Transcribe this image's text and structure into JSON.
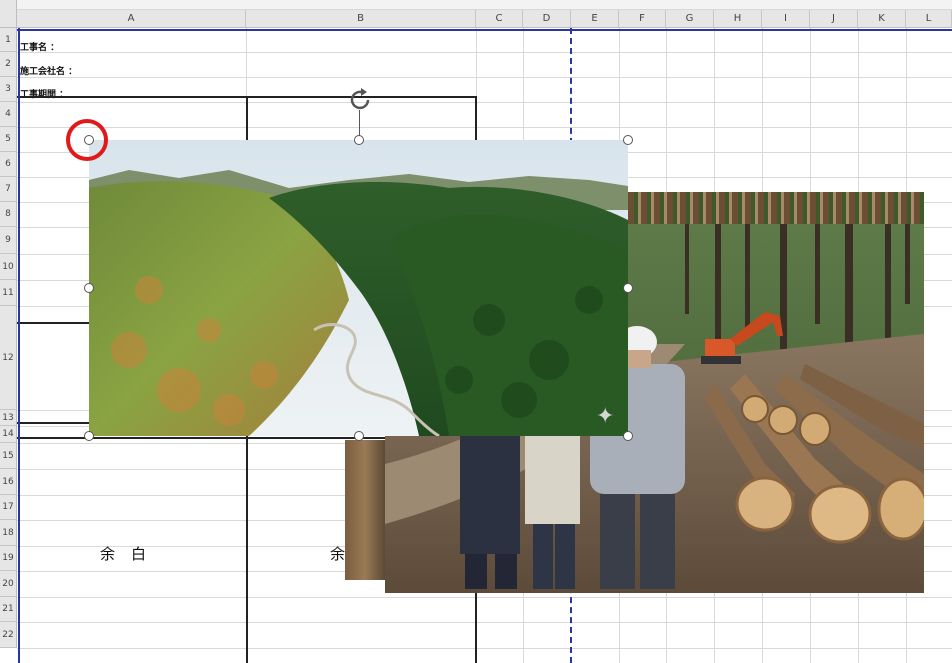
{
  "columns": [
    "A",
    "B",
    "C",
    "D",
    "E",
    "F",
    "G",
    "H",
    "I",
    "J",
    "K",
    "L"
  ],
  "rows": [
    "1",
    "2",
    "3",
    "4",
    "5",
    "6",
    "7",
    "8",
    "9",
    "10",
    "11",
    "12",
    "13",
    "14",
    "15",
    "16",
    "17",
    "18",
    "19",
    "20",
    "21",
    "22"
  ],
  "labels": {
    "construction_name": "工事名 ：",
    "contractor_name": "施工会社名 ：",
    "construction_period": "工事期間 ："
  },
  "blanks": {
    "left": "余　白",
    "right": "余"
  },
  "icons": {
    "rotate": "rotate-handle-icon",
    "sparkle": "sparkle-icon"
  },
  "colors": {
    "page_break": "#2a35a8",
    "highlight_circle": "#e0191b",
    "grid": "#d9d9d9"
  }
}
